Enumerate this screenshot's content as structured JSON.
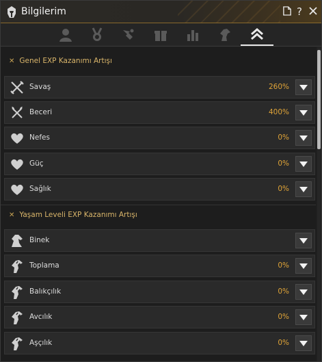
{
  "window": {
    "title": "Bilgilerim"
  },
  "titlebar_buttons": [
    "document-icon",
    "help-icon",
    "close-icon"
  ],
  "tabs": [
    {
      "name": "profile-icon",
      "active": false
    },
    {
      "name": "medal-icon",
      "active": false
    },
    {
      "name": "pet-icon",
      "active": false
    },
    {
      "name": "gift-icon",
      "active": false
    },
    {
      "name": "stats-bars-icon",
      "active": false
    },
    {
      "name": "horse-head-icon",
      "active": false
    },
    {
      "name": "rank-up-icon",
      "active": true
    }
  ],
  "sections": {
    "general": {
      "title": "Genel EXP Kazanımı Artışı",
      "rows": [
        {
          "icon": "crossed-swords-icon",
          "label": "Savaş",
          "value": "260%"
        },
        {
          "icon": "crossed-axes-icon",
          "label": "Beceri",
          "value": "400%"
        },
        {
          "icon": "heart-icon",
          "label": "Nefes",
          "value": "0%"
        },
        {
          "icon": "heart-icon",
          "label": "Güç",
          "value": "0%"
        },
        {
          "icon": "heart-icon",
          "label": "Sağlık",
          "value": "0%"
        }
      ]
    },
    "life": {
      "title": "Yaşam Leveli EXP Kazanımı Artışı",
      "rows": [
        {
          "icon": "horse-icon",
          "label": "Binek",
          "value": ""
        },
        {
          "icon": "life-skill-icon",
          "label": "Toplama",
          "value": "0%"
        },
        {
          "icon": "life-skill-icon",
          "label": "Balıkçılık",
          "value": "0%"
        },
        {
          "icon": "life-skill-icon",
          "label": "Avcılık",
          "value": "0%"
        },
        {
          "icon": "life-skill-icon",
          "label": "Aşçılık",
          "value": "0%"
        }
      ]
    }
  },
  "colors": {
    "accent": "#e0a438",
    "section": "#d9b56a",
    "gold_border": "#8a6a2c"
  }
}
